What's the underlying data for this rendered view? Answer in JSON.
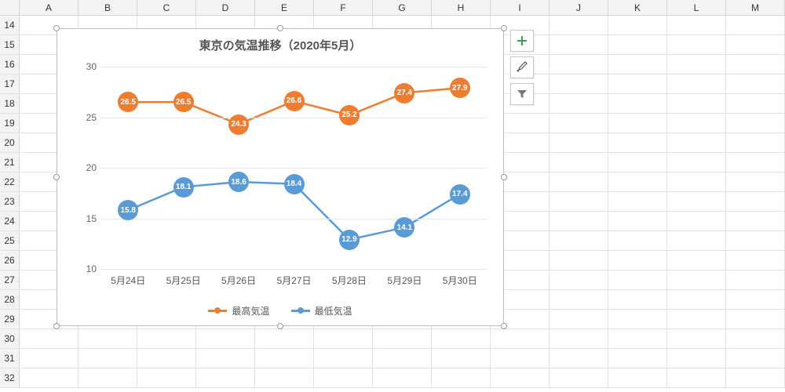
{
  "grid": {
    "columns": [
      "A",
      "B",
      "C",
      "D",
      "E",
      "F",
      "G",
      "H",
      "I",
      "J",
      "K",
      "L",
      "M"
    ],
    "row_start": 14,
    "row_end": 32
  },
  "chart_data": {
    "type": "line",
    "title": "東京の気温推移（2020年5月）",
    "xlabel": "",
    "ylabel": "",
    "ylim": [
      10,
      30
    ],
    "yticks": [
      10,
      15,
      20,
      25,
      30
    ],
    "categories": [
      "5月24日",
      "5月25日",
      "5月26日",
      "5月27日",
      "5月28日",
      "5月29日",
      "5月30日"
    ],
    "series": [
      {
        "name": "最高気温",
        "color": "#ed7d31",
        "values": [
          26.5,
          26.5,
          24.3,
          26.6,
          25.2,
          27.4,
          27.9
        ]
      },
      {
        "name": "最低気温",
        "color": "#5b9bd5",
        "values": [
          15.8,
          18.1,
          18.6,
          18.4,
          12.9,
          14.1,
          17.4
        ]
      }
    ]
  },
  "side_buttons": {
    "add": "plus-icon",
    "style": "brush-icon",
    "filter": "funnel-icon"
  }
}
